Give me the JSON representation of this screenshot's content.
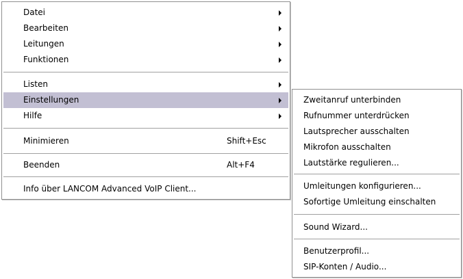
{
  "main_menu": {
    "items": [
      {
        "label": "Datei"
      },
      {
        "label": "Bearbeiten"
      },
      {
        "label": "Leitungen"
      },
      {
        "label": "Funktionen"
      },
      {
        "label": "Listen"
      },
      {
        "label": "Einstellungen"
      },
      {
        "label": "Hilfe"
      },
      {
        "label": "Minimieren",
        "shortcut": "Shift+Esc"
      },
      {
        "label": "Beenden",
        "shortcut": "Alt+F4"
      },
      {
        "label": "Info über LANCOM Advanced VoIP Client..."
      }
    ]
  },
  "submenu_einstellungen": {
    "items": [
      {
        "label": "Zweitanruf unterbinden"
      },
      {
        "label": "Rufnummer unterdrücken"
      },
      {
        "label": "Lautsprecher ausschalten"
      },
      {
        "label": "Mikrofon ausschalten"
      },
      {
        "label": "Lautstärke regulieren..."
      },
      {
        "label": "Umleitungen konfigurieren..."
      },
      {
        "label": "Sofortige Umleitung einschalten"
      },
      {
        "label": "Sound Wizard..."
      },
      {
        "label": "Benutzerprofil..."
      },
      {
        "label": "SIP-Konten / Audio..."
      }
    ]
  },
  "colors": {
    "highlight": "#c2bfd3",
    "border": "#8f8f8f",
    "separator": "#a0a0a0"
  },
  "icons": {
    "submenu_arrow": "chevron-right-icon"
  }
}
